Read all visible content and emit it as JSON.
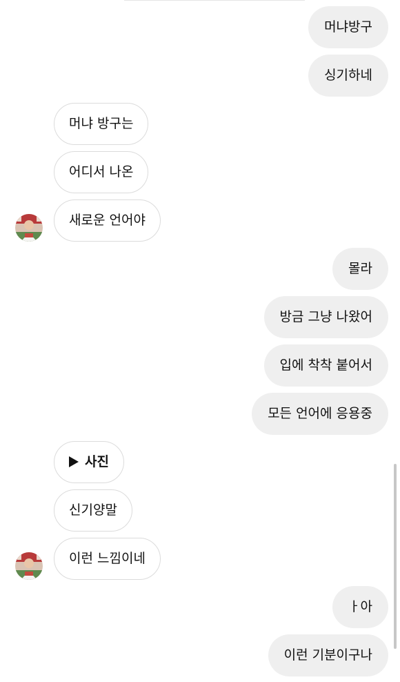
{
  "messages": [
    {
      "from": "me",
      "text": "머냐방구"
    },
    {
      "from": "me",
      "text": "싱기하네"
    },
    {
      "from": "other",
      "text": "머냐 방구는"
    },
    {
      "from": "other",
      "text": "어디서 나온"
    },
    {
      "from": "other",
      "text": "새로운 언어야"
    },
    {
      "from": "me",
      "text": "몰라"
    },
    {
      "from": "me",
      "text": "방금 그냥 나왔어"
    },
    {
      "from": "me",
      "text": "입에 착착 붙어서"
    },
    {
      "from": "me",
      "text": "모든 언어에 응용중"
    },
    {
      "from": "other",
      "type": "media",
      "text": "사진"
    },
    {
      "from": "other",
      "text": "신기양말"
    },
    {
      "from": "other",
      "text": "이런 느낌이네"
    },
    {
      "from": "me",
      "text": "ㅏ아"
    },
    {
      "from": "me",
      "text": "이런 기분이구나"
    }
  ],
  "icons": {
    "avatar": "profile-photo",
    "play": "play-icon"
  },
  "colors": {
    "sent_bubble": "#efefef",
    "received_border": "#dbdbdb",
    "background": "#ffffff"
  }
}
